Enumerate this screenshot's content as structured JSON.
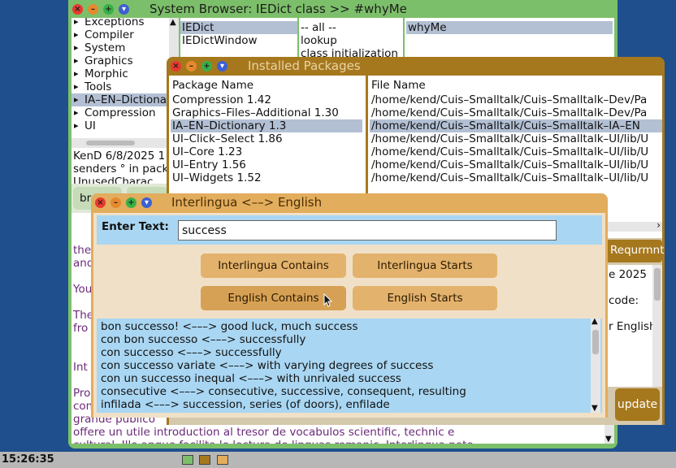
{
  "browser": {
    "title": "System Browser: IEDict class >> #whyMe",
    "categories": [
      "Exceptions",
      "Compiler",
      "System",
      "Graphics",
      "Morphic",
      "Tools",
      "IA–EN–Dictionary",
      "Compression",
      "UI"
    ],
    "classes": [
      "IEDict",
      "IEDictWindow"
    ],
    "protocols": [
      "-- all --",
      "lookup",
      "class initialization"
    ],
    "methods": [
      "whyMe"
    ],
    "info_line1": "KenD 6/8/2025 1",
    "info_line2": "senders ° in pack",
    "info_line3": "UnusedCharac",
    "browse_button": "br",
    "code_lines": [
      "the",
      "and",
      "You",
      "The",
      "fro",
      "Int",
      "Pro",
      "con",
      "grande publico",
      "offere un utile introduction al tresor de vocabulos scientific, technic e",
      "cultural. Illo anque facilita le lectura de linguas romanic. Interlingua note"
    ],
    "right_snips": [
      "Requrmnt",
      "e 2025",
      "code:",
      "r English"
    ],
    "update_label": "update"
  },
  "packages": {
    "title": "Installed Packages",
    "col_name": "Package Name",
    "col_file": "File Name",
    "names": [
      "Compression 1.42",
      "Graphics–Files–Additional 1.30",
      "IA–EN–Dictionary 1.3",
      "UI–Click–Select 1.86",
      "UI–Core 1.23",
      "UI–Entry 1.56",
      "UI–Widgets 1.52"
    ],
    "files": [
      "/home/kend/Cuis–Smalltalk/Cuis–Smalltalk–Dev/Pa",
      "/home/kend/Cuis–Smalltalk/Cuis–Smalltalk–Dev/Pa",
      "/home/kend/Cuis–Smalltalk/Cuis–Smalltalk–IA–EN",
      "/home/kend/Cuis–Smalltalk/Cuis–Smalltalk–UI/lib/U",
      "/home/kend/Cuis–Smalltalk/Cuis–Smalltalk–UI/lib/U",
      "/home/kend/Cuis–Smalltalk/Cuis–Smalltalk–UI/lib/U",
      "/home/kend/Cuis–Smalltalk/Cuis–Smalltalk–UI/lib/U"
    ]
  },
  "dict": {
    "title": "Interlingua <––> English",
    "enter_label": "Enter Text:",
    "input_value": "success",
    "btn_ia_contains": "Interlingua Contains",
    "btn_ia_starts": "Interlingua Starts",
    "btn_en_contains": "English Contains",
    "btn_en_starts": "English Starts",
    "results": [
      "bon successo! <–––> good luck, much success",
      "con bon successo <–––> successfully",
      "con successo <–––> successfully",
      "con successo variate <–––> with varying degrees of success",
      "con un successo inequal <–––> with unrivaled success",
      "consecutive <–––> consecutive, successive, consequent, resulting",
      "infilada <–––> succession, series (of doors), enfilade"
    ]
  },
  "taskbar": {
    "clock": "15:26:35"
  },
  "colors": {
    "desktop": "#1f4f8c",
    "browser_frame": "#7cbf6a",
    "packages_frame": "#a6781e",
    "dict_frame": "#e2ad5d"
  }
}
